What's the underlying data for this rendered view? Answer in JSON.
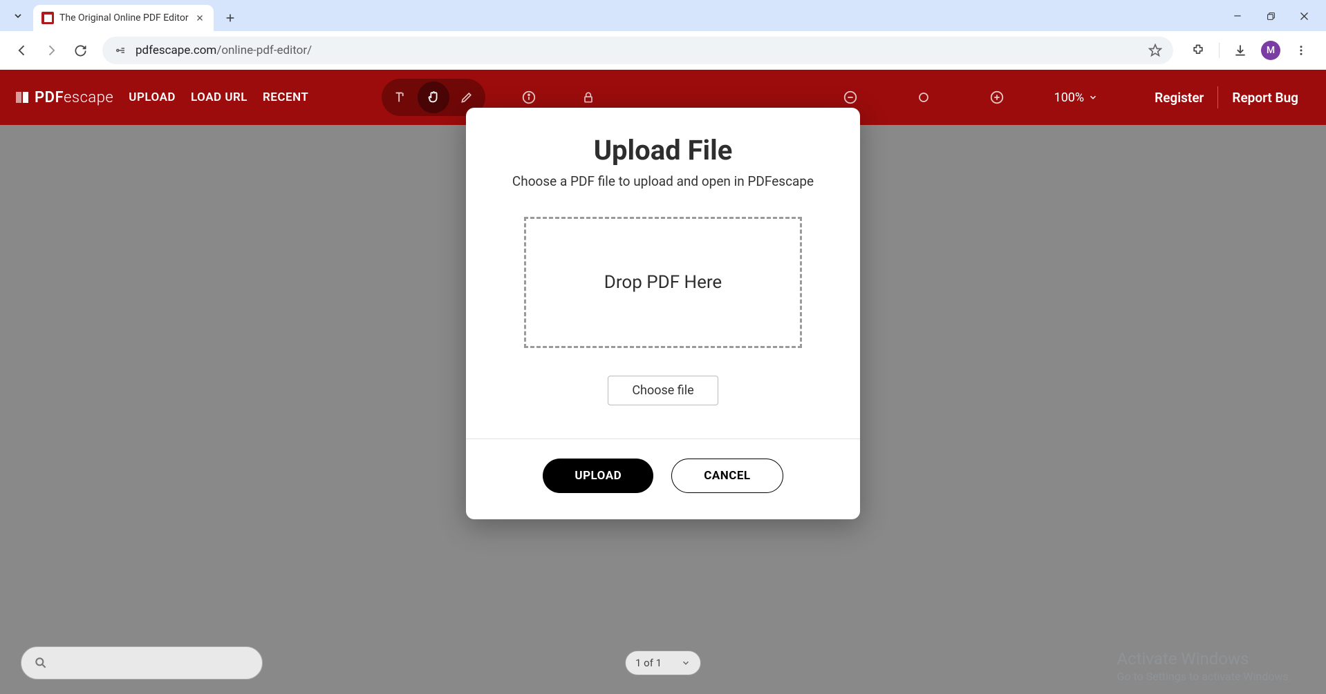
{
  "browser": {
    "tab_title": "The Original Online PDF Editor",
    "url_domain": "pdfescape.com",
    "url_path": "/online-pdf-editor/",
    "profile_letter": "M"
  },
  "app": {
    "logo": "PDFescape",
    "nav": {
      "upload": "UPLOAD",
      "load_url": "LOAD URL",
      "recent": "RECENT"
    },
    "zoom": "100%",
    "register": "Register",
    "report_bug": "Report Bug"
  },
  "modal": {
    "title": "Upload File",
    "subtitle": "Choose a PDF file to upload and open in PDFescape",
    "dropzone": "Drop PDF Here",
    "choose_file": "Choose file",
    "upload_btn": "UPLOAD",
    "cancel_btn": "CANCEL"
  },
  "footer": {
    "page_select": "1 of 1"
  },
  "watermark": {
    "title": "Activate Windows",
    "sub": "Go to Settings to activate Windows."
  }
}
